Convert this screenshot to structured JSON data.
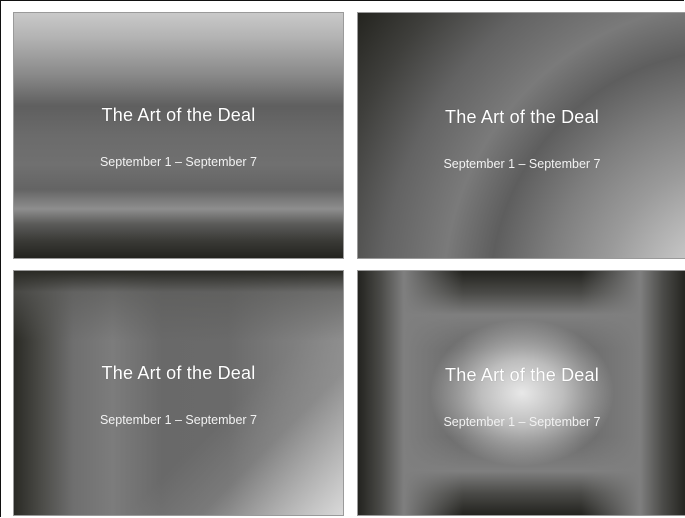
{
  "slides": [
    {
      "title": "The Art of the Deal",
      "subtitle": "September 1 – September 7",
      "style": "linear-horizontal-bands"
    },
    {
      "title": "The Art of the Deal",
      "subtitle": "September 1 – September 7",
      "style": "radial-from-bottom-right"
    },
    {
      "title": "The Art of the Deal",
      "subtitle": "September 1 – September 7",
      "style": "corner-from-top-left"
    },
    {
      "title": "The Art of the Deal",
      "subtitle": "September 1 – September 7",
      "style": "rectangular-from-center"
    }
  ],
  "colors": {
    "background": "#ffffff",
    "text": "#ffffff",
    "dark": "#23231f",
    "light": "#efefef"
  }
}
